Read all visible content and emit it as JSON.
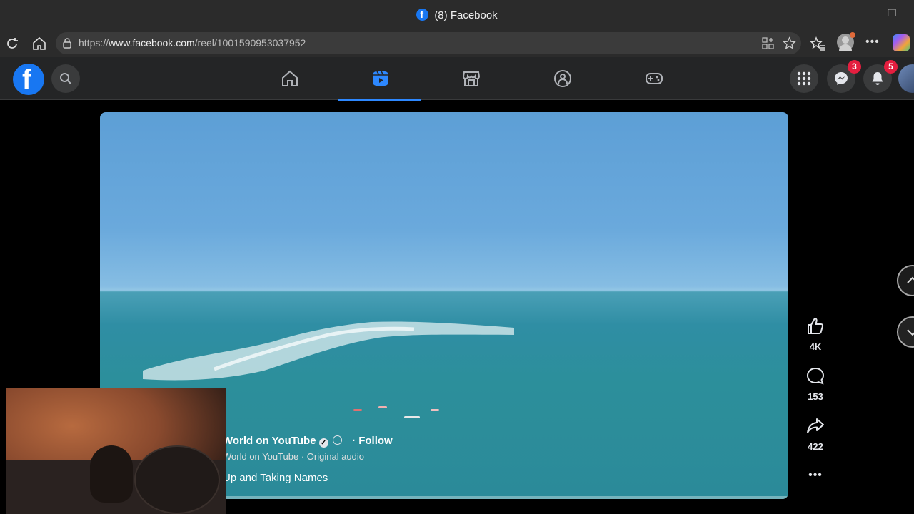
{
  "browser": {
    "title": "(8) Facebook",
    "url_prefix": "https://",
    "url_domain": "www.facebook.com",
    "url_path": "/reel/1001590953037952"
  },
  "fb_nav": {
    "logo": "f",
    "messenger_badge": "3",
    "notifications_badge": "5",
    "active_tab": "reels"
  },
  "reel": {
    "author": "World on YouTube",
    "follow_label": "· Follow",
    "audio_line": "World on YouTube · Original audio",
    "caption": "Up and Taking Names",
    "likes": "4K",
    "comments": "153",
    "shares": "422"
  },
  "colors": {
    "accent": "#1877f2",
    "active_tab": "#2d88ff",
    "badge": "#e41e3f"
  }
}
